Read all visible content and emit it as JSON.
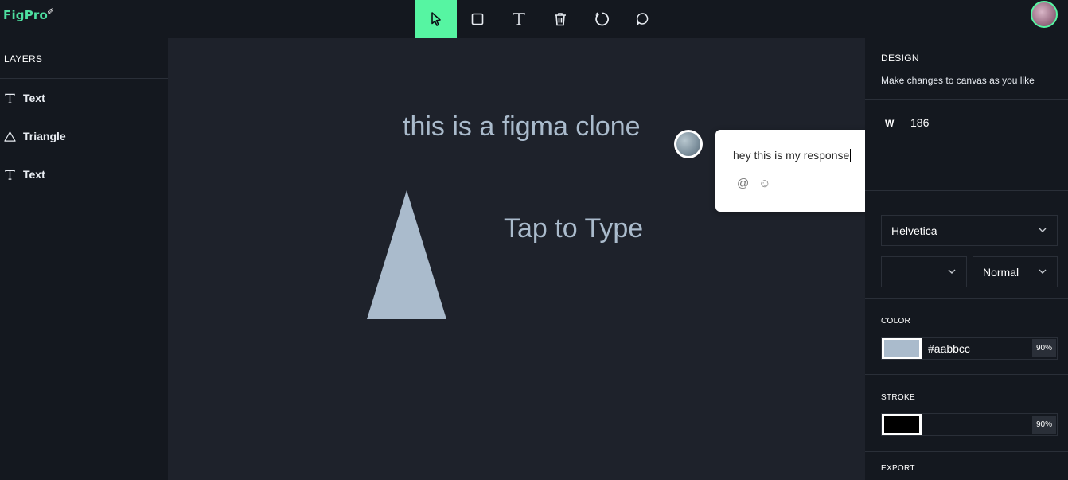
{
  "app": {
    "logo": "FigPro"
  },
  "toolbar": {
    "tools": [
      {
        "name": "select",
        "icon": "cursor-icon",
        "active": true
      },
      {
        "name": "rectangle",
        "icon": "square-icon"
      },
      {
        "name": "text",
        "icon": "text-icon"
      },
      {
        "name": "delete",
        "icon": "trash-icon"
      },
      {
        "name": "reset",
        "icon": "refresh-icon"
      },
      {
        "name": "comment",
        "icon": "comment-icon"
      }
    ],
    "accent": "#56f5a2"
  },
  "layers": {
    "title": "LAYERS",
    "items": [
      {
        "label": "Text",
        "icon": "text-icon"
      },
      {
        "label": "Triangle",
        "icon": "triangle-icon"
      },
      {
        "label": "Text",
        "icon": "text-icon"
      }
    ]
  },
  "canvas": {
    "text1": "this is a figma clone",
    "text2": "Tap to Type",
    "shape_color": "#aabbcc"
  },
  "comment": {
    "text": "hey this is my response",
    "icons": [
      "at-icon",
      "emoji-icon"
    ]
  },
  "design": {
    "title": "DESIGN",
    "subtitle": "Make changes to canvas as you like",
    "w_label": "W",
    "w_value": "186",
    "font_family": "Helvetica",
    "font_size": "",
    "font_weight": "Normal"
  },
  "color": {
    "label": "COLOR",
    "hex": "#aabbcc",
    "opacity": "90%"
  },
  "stroke": {
    "label": "STROKE",
    "hex": "",
    "opacity": "90%",
    "swatch": "#000000"
  },
  "export": {
    "label": "EXPORT"
  }
}
